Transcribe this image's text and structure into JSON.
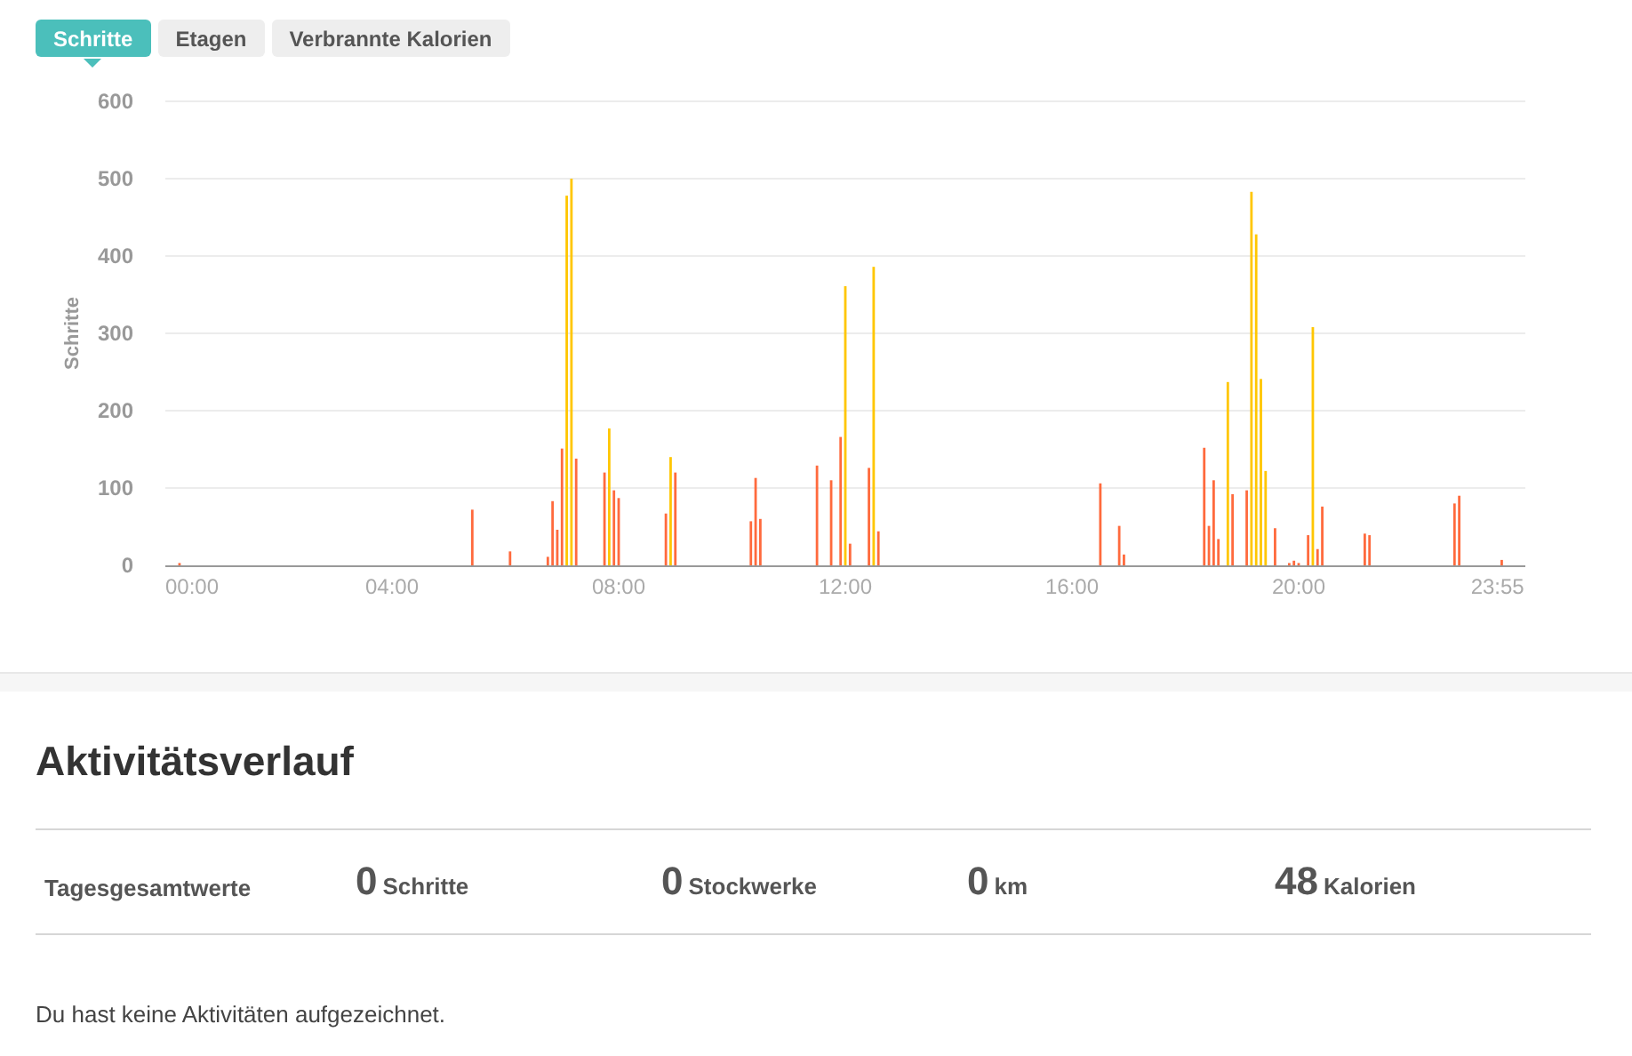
{
  "tabs": [
    {
      "label": "Schritte",
      "selected": true
    },
    {
      "label": "Etagen",
      "selected": false
    },
    {
      "label": "Verbrannte Kalorien",
      "selected": false
    }
  ],
  "chart": {
    "chart_data": {
      "type": "bar",
      "grid": true,
      "ylabel": "Schritte",
      "xlim": [
        0,
        1440
      ],
      "ylim": [
        0,
        600
      ],
      "yticks": [
        0,
        100,
        200,
        300,
        400,
        500,
        600
      ],
      "xticks": [
        {
          "value": 0,
          "label": "00:00"
        },
        {
          "value": 240,
          "label": "04:00"
        },
        {
          "value": 480,
          "label": "08:00"
        },
        {
          "value": 720,
          "label": "12:00"
        },
        {
          "value": 960,
          "label": "16:00"
        },
        {
          "value": 1200,
          "label": "20:00"
        },
        {
          "value": 1435,
          "label": "23:55"
        }
      ],
      "x": [
        15,
        325,
        365,
        405,
        410,
        415,
        420,
        425,
        430,
        435,
        465,
        470,
        475,
        480,
        530,
        535,
        540,
        620,
        625,
        630,
        690,
        705,
        715,
        720,
        725,
        745,
        750,
        755,
        990,
        1010,
        1015,
        1100,
        1105,
        1110,
        1115,
        1125,
        1130,
        1145,
        1150,
        1155,
        1160,
        1165,
        1175,
        1190,
        1195,
        1200,
        1210,
        1215,
        1220,
        1225,
        1270,
        1275,
        1365,
        1370,
        1415
      ],
      "series": [
        {
          "color": "#ff6a3d",
          "values": [
            3,
            72,
            18,
            11,
            83,
            46,
            151,
            null,
            null,
            138,
            120,
            null,
            97,
            87,
            67,
            null,
            120,
            57,
            113,
            60,
            129,
            110,
            166,
            null,
            28,
            126,
            null,
            44,
            106,
            51,
            14,
            152,
            51,
            110,
            34,
            null,
            92,
            97,
            null,
            null,
            null,
            null,
            48,
            3,
            6,
            3,
            39,
            null,
            21,
            76,
            41,
            39,
            80,
            90,
            7
          ]
        },
        {
          "color": "#ffc600",
          "values": [
            null,
            null,
            null,
            null,
            null,
            null,
            null,
            478,
            500,
            null,
            null,
            177,
            null,
            null,
            null,
            140,
            null,
            null,
            null,
            null,
            null,
            null,
            null,
            361,
            null,
            null,
            386,
            null,
            null,
            null,
            null,
            null,
            null,
            null,
            null,
            237,
            null,
            null,
            483,
            428,
            241,
            122,
            null,
            null,
            null,
            null,
            null,
            308,
            null,
            null,
            null,
            null,
            null,
            null,
            null
          ]
        }
      ]
    }
  },
  "activity": {
    "title": "Aktivitätsverlauf",
    "totals": {
      "label": "Tagesgesamtwerte",
      "items": [
        {
          "value": "0",
          "unit": "Schritte"
        },
        {
          "value": "0",
          "unit": "Stockwerke"
        },
        {
          "value": "0",
          "unit": "km"
        },
        {
          "value": "48",
          "unit": "Kalorien"
        }
      ]
    },
    "message": "Du hast keine Aktivitäten aufgezeichnet."
  }
}
